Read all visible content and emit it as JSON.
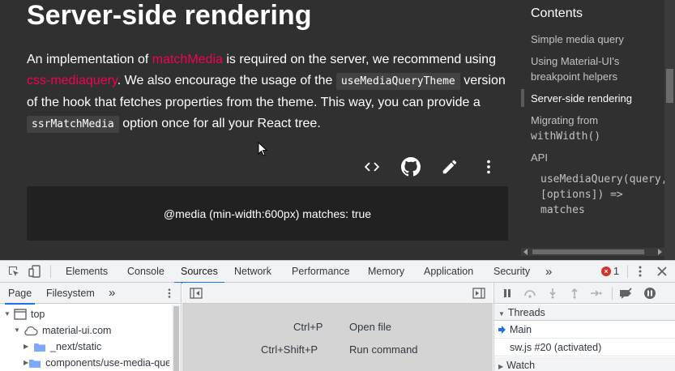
{
  "article": {
    "heading": "Server-side rendering",
    "para": {
      "t1": "An implementation of ",
      "link1": "matchMedia",
      "t2": " is required on the server, we recommend using ",
      "link2": "css-mediaquery",
      "t3": ". We also encourage the usage of the ",
      "code1": "useMediaQueryTheme",
      "t4": " version of the hook that fetches properties from the theme. This way, you can provide a ",
      "code2": "ssrMatchMedia",
      "t5": " option once for all your React tree."
    },
    "toolbar": [
      "code-icon",
      "github-icon",
      "pencil-icon",
      "more-vert-icon"
    ],
    "demo_output": "@media (min-width:600px) matches: true"
  },
  "toc": {
    "title": "Contents",
    "items": [
      {
        "label": "Simple media query"
      },
      {
        "label": "Using Material-UI's breakpoint helpers"
      },
      {
        "label": "Server-side rendering",
        "active": true
      },
      {
        "label": "Migrating from",
        "code": "withWidth()"
      },
      {
        "label": "API"
      }
    ],
    "sub_lines": [
      "useMediaQuery(query,",
      "[options]) =>",
      "matches"
    ]
  },
  "devtools": {
    "tabs": [
      "Elements",
      "Console",
      "Sources",
      "Network",
      "Performance",
      "Memory",
      "Application",
      "Security"
    ],
    "active_tab": "Sources",
    "more": "»",
    "error_count": "1",
    "navigator": {
      "tabs": [
        "Page",
        "Filesystem"
      ],
      "more": "»",
      "tree": [
        {
          "label": "top",
          "icon": "frame-icon"
        },
        {
          "label": "material-ui.com",
          "icon": "cloud-icon"
        },
        {
          "label": "_next/static",
          "icon": "folder-icon"
        },
        {
          "label": "components/use-media-query",
          "icon": "folder-icon"
        }
      ]
    },
    "shortcuts": [
      {
        "keys": "Ctrl+P",
        "action": "Open file"
      },
      {
        "keys": "Ctrl+Shift+P",
        "action": "Run command"
      }
    ],
    "debugger": {
      "threads_label": "Threads",
      "threads": [
        "Main",
        "sw.js #20 (activated)"
      ],
      "watch_label": "Watch"
    },
    "colors": {
      "accent": "#1a73e8",
      "error": "#d93025",
      "link": "#f50057"
    }
  }
}
